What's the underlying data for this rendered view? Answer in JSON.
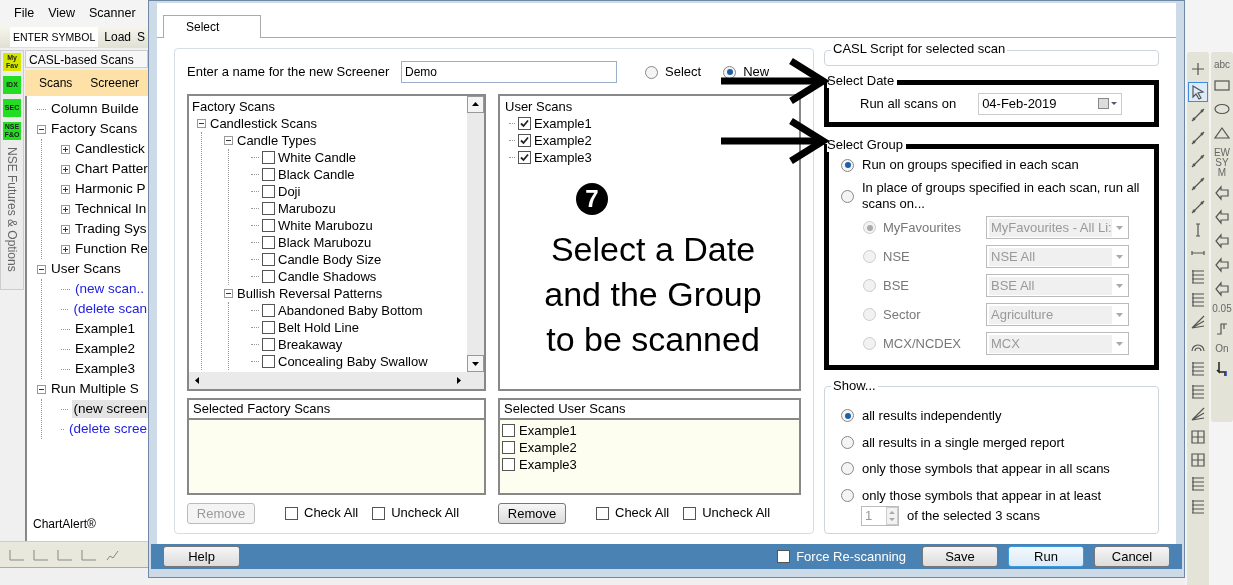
{
  "app": {
    "menu": [
      "File",
      "View",
      "Scanner"
    ],
    "toolbar": {
      "symbol_field": "ENTER SYMBOL",
      "buttons": [
        "Load",
        "S"
      ]
    },
    "side_tabs": [
      {
        "label": "My Fav",
        "color": "#d4e600"
      },
      {
        "label": "IDX",
        "color": "#22dd22"
      },
      {
        "label": "SEC",
        "color": "#22dd22"
      },
      {
        "label": "NSE F&O",
        "color": "#22dd22"
      }
    ],
    "side_caption": "NSE Futures & Options",
    "panel_title": "CASL-based Scans",
    "panel_tabs": [
      {
        "label": "Scans",
        "selected": false
      },
      {
        "label": "Screener",
        "selected": false
      }
    ],
    "tree": [
      {
        "label": "Column Builde",
        "kind": "item",
        "selected": false
      },
      {
        "label": "Factory Scans",
        "kind": "item",
        "selected": false,
        "expanded": true,
        "children": [
          {
            "label": "Candlestick",
            "kind": "item",
            "selected": false,
            "expanded": false
          },
          {
            "label": "Chart Patter",
            "kind": "item",
            "selected": false,
            "expanded": false
          },
          {
            "label": "Harmonic P",
            "kind": "item",
            "selected": false,
            "expanded": false
          },
          {
            "label": "Technical In",
            "kind": "item",
            "selected": false,
            "expanded": false
          },
          {
            "label": "Trading Sys",
            "kind": "item",
            "selected": false,
            "expanded": false
          },
          {
            "label": "Function Re",
            "kind": "item",
            "selected": false,
            "expanded": false
          }
        ]
      },
      {
        "label": "User Scans",
        "kind": "item",
        "selected": false,
        "expanded": true,
        "children": [
          {
            "label": "(new scan..",
            "kind": "action",
            "selected": false
          },
          {
            "label": "(delete scan",
            "kind": "action",
            "selected": false
          },
          {
            "label": "Example1",
            "kind": "item",
            "selected": false
          },
          {
            "label": "Example2",
            "kind": "item",
            "selected": false
          },
          {
            "label": "Example3",
            "kind": "item",
            "selected": false
          }
        ]
      },
      {
        "label": "Run Multiple S",
        "kind": "item",
        "selected": false,
        "expanded": true,
        "children": [
          {
            "label": "(new screen",
            "kind": "item",
            "selected": true
          },
          {
            "label": "(delete scree",
            "kind": "action",
            "selected": false
          }
        ]
      }
    ],
    "footer": "ChartAlert®"
  },
  "dialog": {
    "tabs": [
      {
        "label": "Select",
        "selected": true
      }
    ],
    "name_label": "Enter a name for the new Screener",
    "name_value": "Demo",
    "modes": [
      {
        "label": "Select",
        "selected": false
      },
      {
        "label": "New",
        "selected": true
      }
    ],
    "factory_tree": {
      "title": "Factory Scans",
      "children": [
        {
          "label": "Candlestick Scans",
          "expanded": true,
          "children": [
            {
              "label": "Candle Types",
              "expanded": true,
              "children": [
                {
                  "label": "White Candle",
                  "checked": false
                },
                {
                  "label": "Black Candle",
                  "checked": false
                },
                {
                  "label": "Doji",
                  "checked": false
                },
                {
                  "label": "Marubozu",
                  "checked": false
                },
                {
                  "label": "White Marubozu",
                  "checked": false
                },
                {
                  "label": "Black Marubozu",
                  "checked": false
                },
                {
                  "label": "Candle Body Size",
                  "checked": false
                },
                {
                  "label": "Candle Shadows",
                  "checked": false
                }
              ]
            },
            {
              "label": "Bullish Reversal Patterns",
              "expanded": true,
              "children": [
                {
                  "label": "Abandoned Baby Bottom",
                  "checked": false
                },
                {
                  "label": "Belt Hold Line",
                  "checked": false
                },
                {
                  "label": "Breakaway",
                  "checked": false
                },
                {
                  "label": "Concealing Baby Swallow",
                  "checked": false
                }
              ]
            }
          ]
        }
      ]
    },
    "user_scans": {
      "title": "User Scans",
      "items": [
        {
          "label": "Example1",
          "checked": true
        },
        {
          "label": "Example2",
          "checked": true
        },
        {
          "label": "Example3",
          "checked": true
        }
      ]
    },
    "selected_factory": {
      "title": "Selected Factory Scans",
      "remove": {
        "label": "Remove",
        "disabled": true
      },
      "check_all": {
        "label": "Check All",
        "checked": false
      },
      "uncheck_all": {
        "label": "Uncheck All",
        "checked": false
      }
    },
    "selected_user": {
      "title": "Selected User Scans",
      "items": [
        {
          "label": "Example1",
          "checked": false
        },
        {
          "label": "Example2",
          "checked": false
        },
        {
          "label": "Example3",
          "checked": false
        }
      ],
      "remove": {
        "label": "Remove",
        "disabled": false
      },
      "check_all": {
        "label": "Check All",
        "checked": false
      },
      "uncheck_all": {
        "label": "Uncheck All",
        "checked": false
      }
    },
    "casl_title": "CASL Script for selected scan",
    "select_date": {
      "title": "Select Date",
      "label": "Run all scans on",
      "value": "04-Feb-2019"
    },
    "select_group": {
      "title": "Select Group",
      "options": [
        {
          "label": "Run on groups specified in each scan",
          "selected": true
        },
        {
          "label": "In place of groups specified in each scan, run all scans on...",
          "selected": false
        }
      ],
      "groups": [
        {
          "label": "MyFavourites",
          "value": "MyFavourites - All Li:",
          "selected": true,
          "disabled": true
        },
        {
          "label": "NSE",
          "value": "NSE All",
          "selected": false,
          "disabled": true
        },
        {
          "label": "BSE",
          "value": "BSE All",
          "selected": false,
          "disabled": true
        },
        {
          "label": "Sector",
          "value": "Agriculture",
          "selected": false,
          "disabled": true
        },
        {
          "label": "MCX/NCDEX",
          "value": "MCX",
          "selected": false,
          "disabled": true
        }
      ]
    },
    "show": {
      "title": "Show...",
      "options": [
        {
          "label": "all results independently",
          "selected": true
        },
        {
          "label": "all results in a single merged report",
          "selected": false
        },
        {
          "label": "only those symbols that appear in all scans",
          "selected": false
        },
        {
          "label": "only those symbols that appear in at least",
          "selected": false
        }
      ],
      "count": "1",
      "count_suffix": "of the selected 3 scans"
    },
    "footer": {
      "help": "Help",
      "force": {
        "label": "Force Re-scanning",
        "checked": false
      },
      "buttons": [
        {
          "label": "Save",
          "default": false
        },
        {
          "label": "Run",
          "default": true
        },
        {
          "label": "Cancel",
          "default": false
        }
      ]
    },
    "annotation": {
      "badge": "7",
      "text": "Select a Date and the Group to be scanned"
    }
  },
  "drawing_tools": {
    "left": [
      {
        "kind": "plus",
        "selected": false
      },
      {
        "kind": "pointer",
        "selected": true
      },
      {
        "kind": "line",
        "selected": false
      },
      {
        "kind": "line",
        "selected": false
      },
      {
        "kind": "line",
        "selected": false
      },
      {
        "kind": "line",
        "selected": false
      },
      {
        "kind": "line",
        "selected": false
      },
      {
        "kind": "vsegment",
        "selected": false
      },
      {
        "kind": "hsegment",
        "selected": false
      },
      {
        "kind": "fib",
        "selected": false
      },
      {
        "kind": "fib",
        "selected": false
      },
      {
        "kind": "fan",
        "selected": false
      },
      {
        "kind": "arc",
        "selected": false
      },
      {
        "kind": "fib",
        "selected": false
      },
      {
        "kind": "fib",
        "selected": false
      },
      {
        "kind": "fan",
        "selected": false
      },
      {
        "kind": "grid",
        "selected": false
      },
      {
        "kind": "grid",
        "selected": false
      },
      {
        "kind": "fib",
        "selected": false
      },
      {
        "kind": "fib",
        "selected": false
      }
    ],
    "right": [
      {
        "kind": "text",
        "text": "abc",
        "selected": false
      },
      {
        "kind": "rect",
        "selected": false
      },
      {
        "kind": "ellipse",
        "selected": false
      },
      {
        "kind": "triangle",
        "selected": false
      },
      {
        "kind": "text",
        "text": "EW SYM",
        "selected": false
      },
      {
        "kind": "arrow",
        "selected": false
      },
      {
        "kind": "arrow",
        "selected": false
      },
      {
        "kind": "arrow",
        "selected": false
      },
      {
        "kind": "arrow",
        "selected": false
      },
      {
        "kind": "arrow",
        "selected": false
      },
      {
        "kind": "text",
        "text": "0.05",
        "selected": false
      },
      {
        "kind": "step",
        "selected": false
      },
      {
        "kind": "text",
        "text": "On",
        "selected": false
      },
      {
        "kind": "cursor",
        "selected": false
      }
    ]
  }
}
